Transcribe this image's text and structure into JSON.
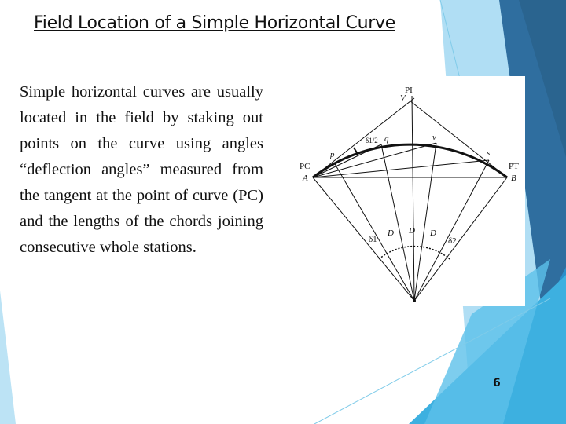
{
  "slide": {
    "title": "Field Location of a Simple Horizontal Curve",
    "body": "Simple horizontal curves are usually located in the field by staking out points on the curve using angles “deflection angles” measured from the tangent at the point of curve (PC) and the lengths of the chords joining consecutive whole stations.",
    "page_number": "6"
  },
  "figure": {
    "labels": {
      "pi": "PI",
      "v_upper": "V",
      "pc": "PC",
      "a": "A",
      "pt": "PT",
      "b": "B",
      "p": "p",
      "q": "q",
      "v": "v",
      "s": "s",
      "delta_half": "δ1/2",
      "delta1": "δ1",
      "delta2": "δ2",
      "d": "D"
    }
  },
  "theme": {
    "dark_blue": "#2e6fa3",
    "mid_blue": "#3aa6d9",
    "light_blue": "#8fd0ef"
  }
}
